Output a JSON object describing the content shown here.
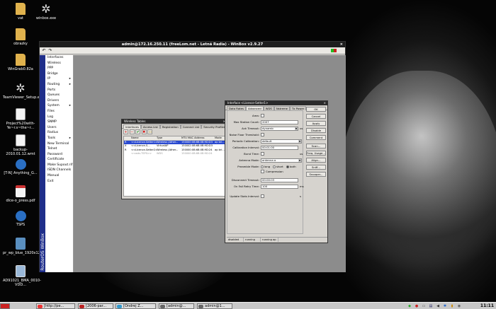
{
  "desktop": {
    "icons": [
      {
        "label": "vat",
        "kind": "folder",
        "icon": "folder-icon"
      },
      {
        "label": "winbox.exe",
        "kind": "gear",
        "icon": "gear-icon"
      },
      {
        "label": "obrazky",
        "kind": "folder",
        "icon": "folder-icon"
      },
      {
        "label": "WinGrab0.82a",
        "kind": "folder",
        "icon": "folder-icon"
      },
      {
        "label": "TeamViewer_Setup.exe",
        "kind": "gear",
        "icon": "gear-icon"
      },
      {
        "label": "Project%20with-Ye~r.s~the~r...",
        "kind": "file",
        "icon": "file-icon"
      },
      {
        "label": "backup-2010.01.12.wmt",
        "kind": "file",
        "icon": "file-icon"
      },
      {
        "label": "[T-N] Anything_G...",
        "kind": "tv",
        "icon": "video-icon"
      },
      {
        "label": "dlce-o_press.pdf",
        "kind": "pdf",
        "icon": "pdf-icon"
      },
      {
        "label": "TSPS",
        "kind": "tv",
        "icon": "app-icon"
      },
      {
        "label": "pr_wp_blue_1920x1200.jpg",
        "kind": "net",
        "icon": "image-icon"
      },
      {
        "label": "AD91021_BMA_0010-VDD...",
        "kind": "pic",
        "icon": "image-icon"
      }
    ]
  },
  "winbox": {
    "title": "admin@172.16.250.11 (freeLom.net - Letná Radia) - WinBox v2.9.27",
    "close": "×",
    "undo": "↶",
    "redo": "↷",
    "brand": "RouterOS WinBox",
    "menu": [
      {
        "label": "Interfaces",
        "arrow": ""
      },
      {
        "label": "Wireless",
        "arrow": ""
      },
      {
        "label": "PPP",
        "arrow": ""
      },
      {
        "label": "Bridge",
        "arrow": ""
      },
      {
        "label": "IP",
        "arrow": "▸"
      },
      {
        "label": "Routing",
        "arrow": "▸"
      },
      {
        "label": "Ports",
        "arrow": ""
      },
      {
        "label": "Queues",
        "arrow": ""
      },
      {
        "label": "Drivers",
        "arrow": ""
      },
      {
        "label": "System",
        "arrow": "▸"
      },
      {
        "label": "Files",
        "arrow": ""
      },
      {
        "label": "Log",
        "arrow": ""
      },
      {
        "label": "SNMP",
        "arrow": ""
      },
      {
        "label": "Users",
        "arrow": ""
      },
      {
        "label": "Radius",
        "arrow": ""
      },
      {
        "label": "Tools",
        "arrow": "▸"
      },
      {
        "label": "New Terminal",
        "arrow": ""
      },
      {
        "label": "Telnet",
        "arrow": ""
      },
      {
        "label": "Password",
        "arrow": ""
      },
      {
        "label": "Certificate",
        "arrow": ""
      },
      {
        "label": "Make Supout.rif",
        "arrow": ""
      },
      {
        "label": "ISDN Channels",
        "arrow": ""
      },
      {
        "label": "Manual",
        "arrow": ""
      },
      {
        "label": "Exit",
        "arrow": ""
      }
    ]
  },
  "iface_list": {
    "title": "Wireless Tables",
    "close": "×",
    "tabs": [
      "Interfaces",
      "Access List",
      "Registration",
      "Connect List",
      "Security Profiles"
    ],
    "tools": [
      "+",
      "−",
      "✔",
      "✖",
      "▭"
    ],
    "columns": [
      "",
      "Name",
      "Type",
      "MTU",
      "MAC Address",
      "Mode"
    ],
    "rows": [
      {
        "flag": "R",
        "name": "<<Licence-Setter1>>",
        "type": "Wireless (Ather...",
        "mtu": "1500",
        "mac": "00:0B:6B:0B:9D:D3",
        "mode": "ap bri...",
        "style": "sel"
      },
      {
        "flag": "X",
        "name": "<<Licence-S...",
        "type": "VirtualAP",
        "mtu": "1500",
        "mac": "02:0B:6B:0B:9D:D3",
        "mode": "",
        "style": ""
      },
      {
        "flag": "R",
        "name": "<<Licence-Setter2>>",
        "type": "Wireless (Ather...",
        "mtu": "1500",
        "mac": "00:0B:6B:0B:9D:24",
        "mode": "ap bri...",
        "style": ""
      },
      {
        "flag": "",
        "name": "<<wds-TSPS>>",
        "type": "WDS",
        "mtu": "1500",
        "mac": "00:0B:6B:0B:9D:24",
        "mode": "",
        "style": "dim"
      }
    ]
  },
  "iface_dialog": {
    "title": "Interface <Licence-Setter1>",
    "close": "×",
    "tabs": [
      "Data Rates",
      "Advanced",
      "WDS",
      "Nstreme",
      "Tx Power"
    ],
    "fields": {
      "area": {
        "label": "Area:",
        "value": ""
      },
      "max_station": {
        "label": "Max Station Count:",
        "value": "2007"
      },
      "ack_timeout": {
        "label": "Ack Timeout:",
        "value": "dynamic",
        "unit": "us"
      },
      "noise_floor": {
        "label": "Noise Floor Threshold:",
        "value": ""
      },
      "periodic_cal": {
        "label": "Periodic Calibration:",
        "value": "default"
      },
      "cal_interval": {
        "label": "Calibration Interval:",
        "value": "00:01:00"
      },
      "burst_time": {
        "label": "Burst Time:",
        "value": "",
        "unit": "us"
      },
      "antenna_mode": {
        "label": "Antenna Mode:",
        "value": "antenna a"
      },
      "preamble": {
        "label": "Preamble Mode:",
        "opt_long": "long",
        "opt_short": "short",
        "opt_both": "both",
        "compression": "Compression"
      },
      "disconnect": {
        "label": "Disconnect Timeout:",
        "value": "00:00:03"
      },
      "on_fail": {
        "label": "On Fail Retry Time:",
        "value": "100",
        "unit": "ms"
      },
      "update_stats": {
        "label": "Update Stats Interval:",
        "value": "",
        "unit": "s"
      }
    },
    "buttons": [
      "OK",
      "Cancel",
      "Apply",
      "Disable",
      "Comment",
      "Scan...",
      "Freq. Usage...",
      "Align...",
      "Sniff...",
      "Snooper..."
    ],
    "status": [
      "disabled",
      "running",
      "running ap"
    ]
  },
  "taskbar": {
    "tasks": [
      {
        "label": "[http://pe...",
        "color": "#e33"
      },
      {
        "label": "[2006-par...",
        "color": "#b22"
      },
      {
        "label": "[Ondrej Z...",
        "color": "#39c"
      },
      {
        "label": "[admin@...",
        "color": "#666"
      },
      {
        "label": "admin@1...",
        "color": "#666"
      }
    ],
    "clock": "11:11"
  }
}
